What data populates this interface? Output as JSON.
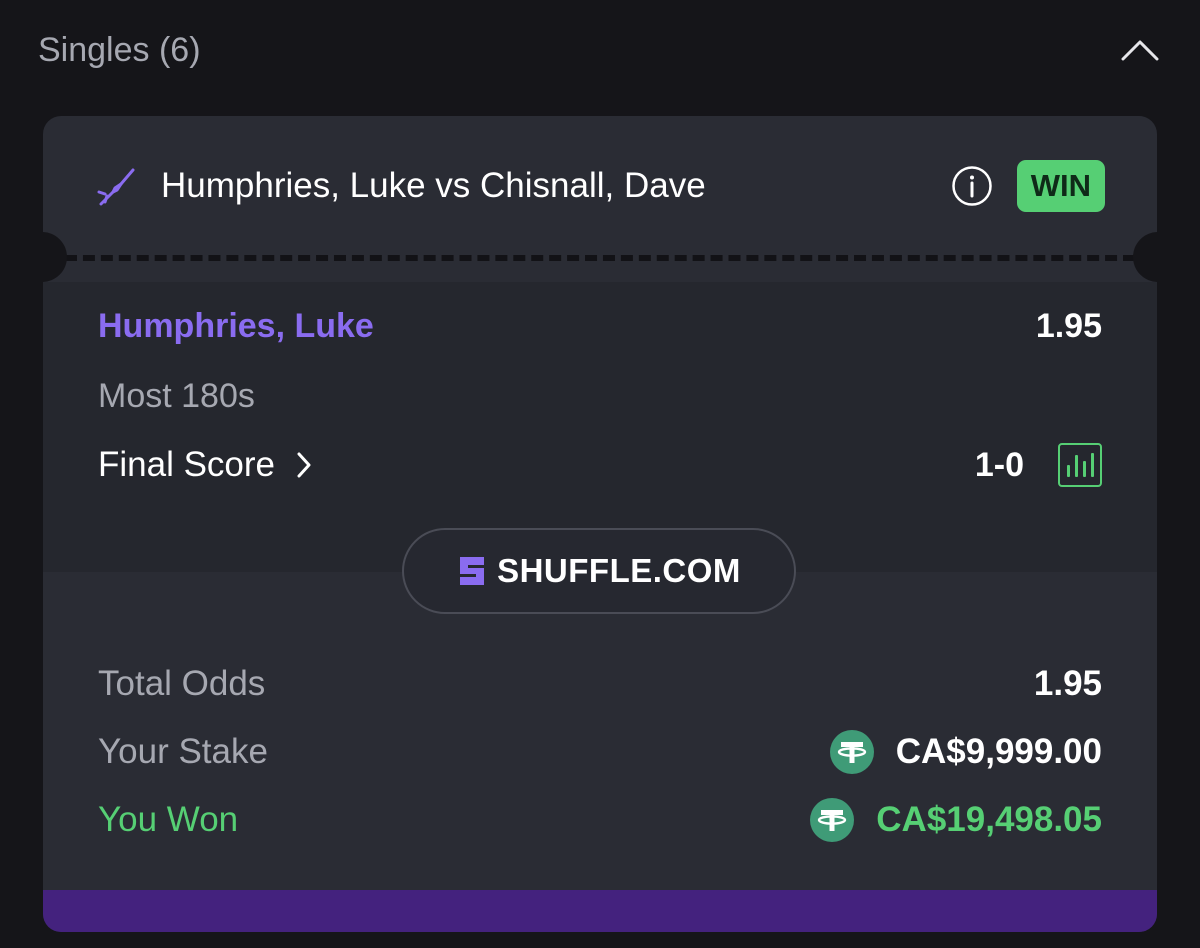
{
  "section": {
    "title": "Singles (6)",
    "collapse_icon": "chevron-up-icon"
  },
  "bet": {
    "sport_icon": "darts-icon",
    "event_name": "Humphries, Luke vs Chisnall, Dave",
    "info_icon": "info-icon",
    "status": "WIN",
    "selection": "Humphries, Luke",
    "selection_odds": "1.95",
    "market": "Most 180s",
    "final_score_label": "Final Score",
    "final_score": "1-0",
    "stats_icon": "bar-chart-icon"
  },
  "brand": {
    "name": "SHUFFLE.COM"
  },
  "summary": {
    "total_odds_label": "Total Odds",
    "total_odds": "1.95",
    "stake_label": "Your Stake",
    "stake": "CA$9,999.00",
    "won_label": "You Won",
    "won": "CA$19,498.05",
    "currency_icon": "tether-icon"
  },
  "colors": {
    "background": "#151519",
    "card": "#2a2c34",
    "accent_purple": "#8a6cf0",
    "win_green": "#56cf74",
    "bottom_bar": "#44227e"
  }
}
